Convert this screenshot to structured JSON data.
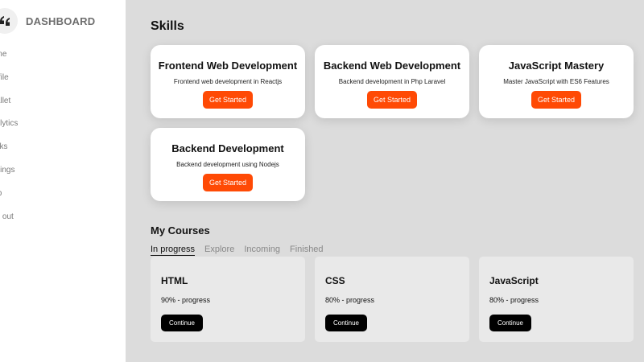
{
  "sidebar": {
    "brand_title": "DASHBOARD",
    "logo_icon": "quote-mark-logo-icon",
    "items": [
      {
        "label": "ome"
      },
      {
        "label": "rofile"
      },
      {
        "label": "Vallet"
      },
      {
        "label": "nalytics"
      },
      {
        "label": "asks"
      },
      {
        "label": "ettings"
      },
      {
        "label": "elp"
      },
      {
        "label": "og out"
      }
    ]
  },
  "skills": {
    "title": "Skills",
    "cards": [
      {
        "name": "Frontend Web Development",
        "description": "Frontend web development in Reactjs",
        "button": "Get Started"
      },
      {
        "name": "Backend Web Development",
        "description": "Backend development in Php Laravel",
        "button": "Get Started"
      },
      {
        "name": "JavaScript Mastery",
        "description": "Master JavaScript with ES6 Features",
        "button": "Get Started"
      },
      {
        "name": "Backend Development",
        "description": "Backend development using Nodejs",
        "button": "Get Started"
      }
    ]
  },
  "courses": {
    "title": "My Courses",
    "tabs": [
      {
        "label": "In progress"
      },
      {
        "label": "Explore"
      },
      {
        "label": "Incoming"
      },
      {
        "label": "Finished"
      }
    ],
    "items": [
      {
        "name": "HTML",
        "progress_text": "90% - progress",
        "button": "Continue"
      },
      {
        "name": "CSS",
        "progress_text": "80% - progress",
        "button": "Continue"
      },
      {
        "name": "JavaScript",
        "progress_text": "80% - progress",
        "button": "Continue"
      }
    ]
  },
  "colors": {
    "accent": "#ff4a05",
    "background": "#dcdcdc",
    "course_card": "#e9e9e9"
  }
}
